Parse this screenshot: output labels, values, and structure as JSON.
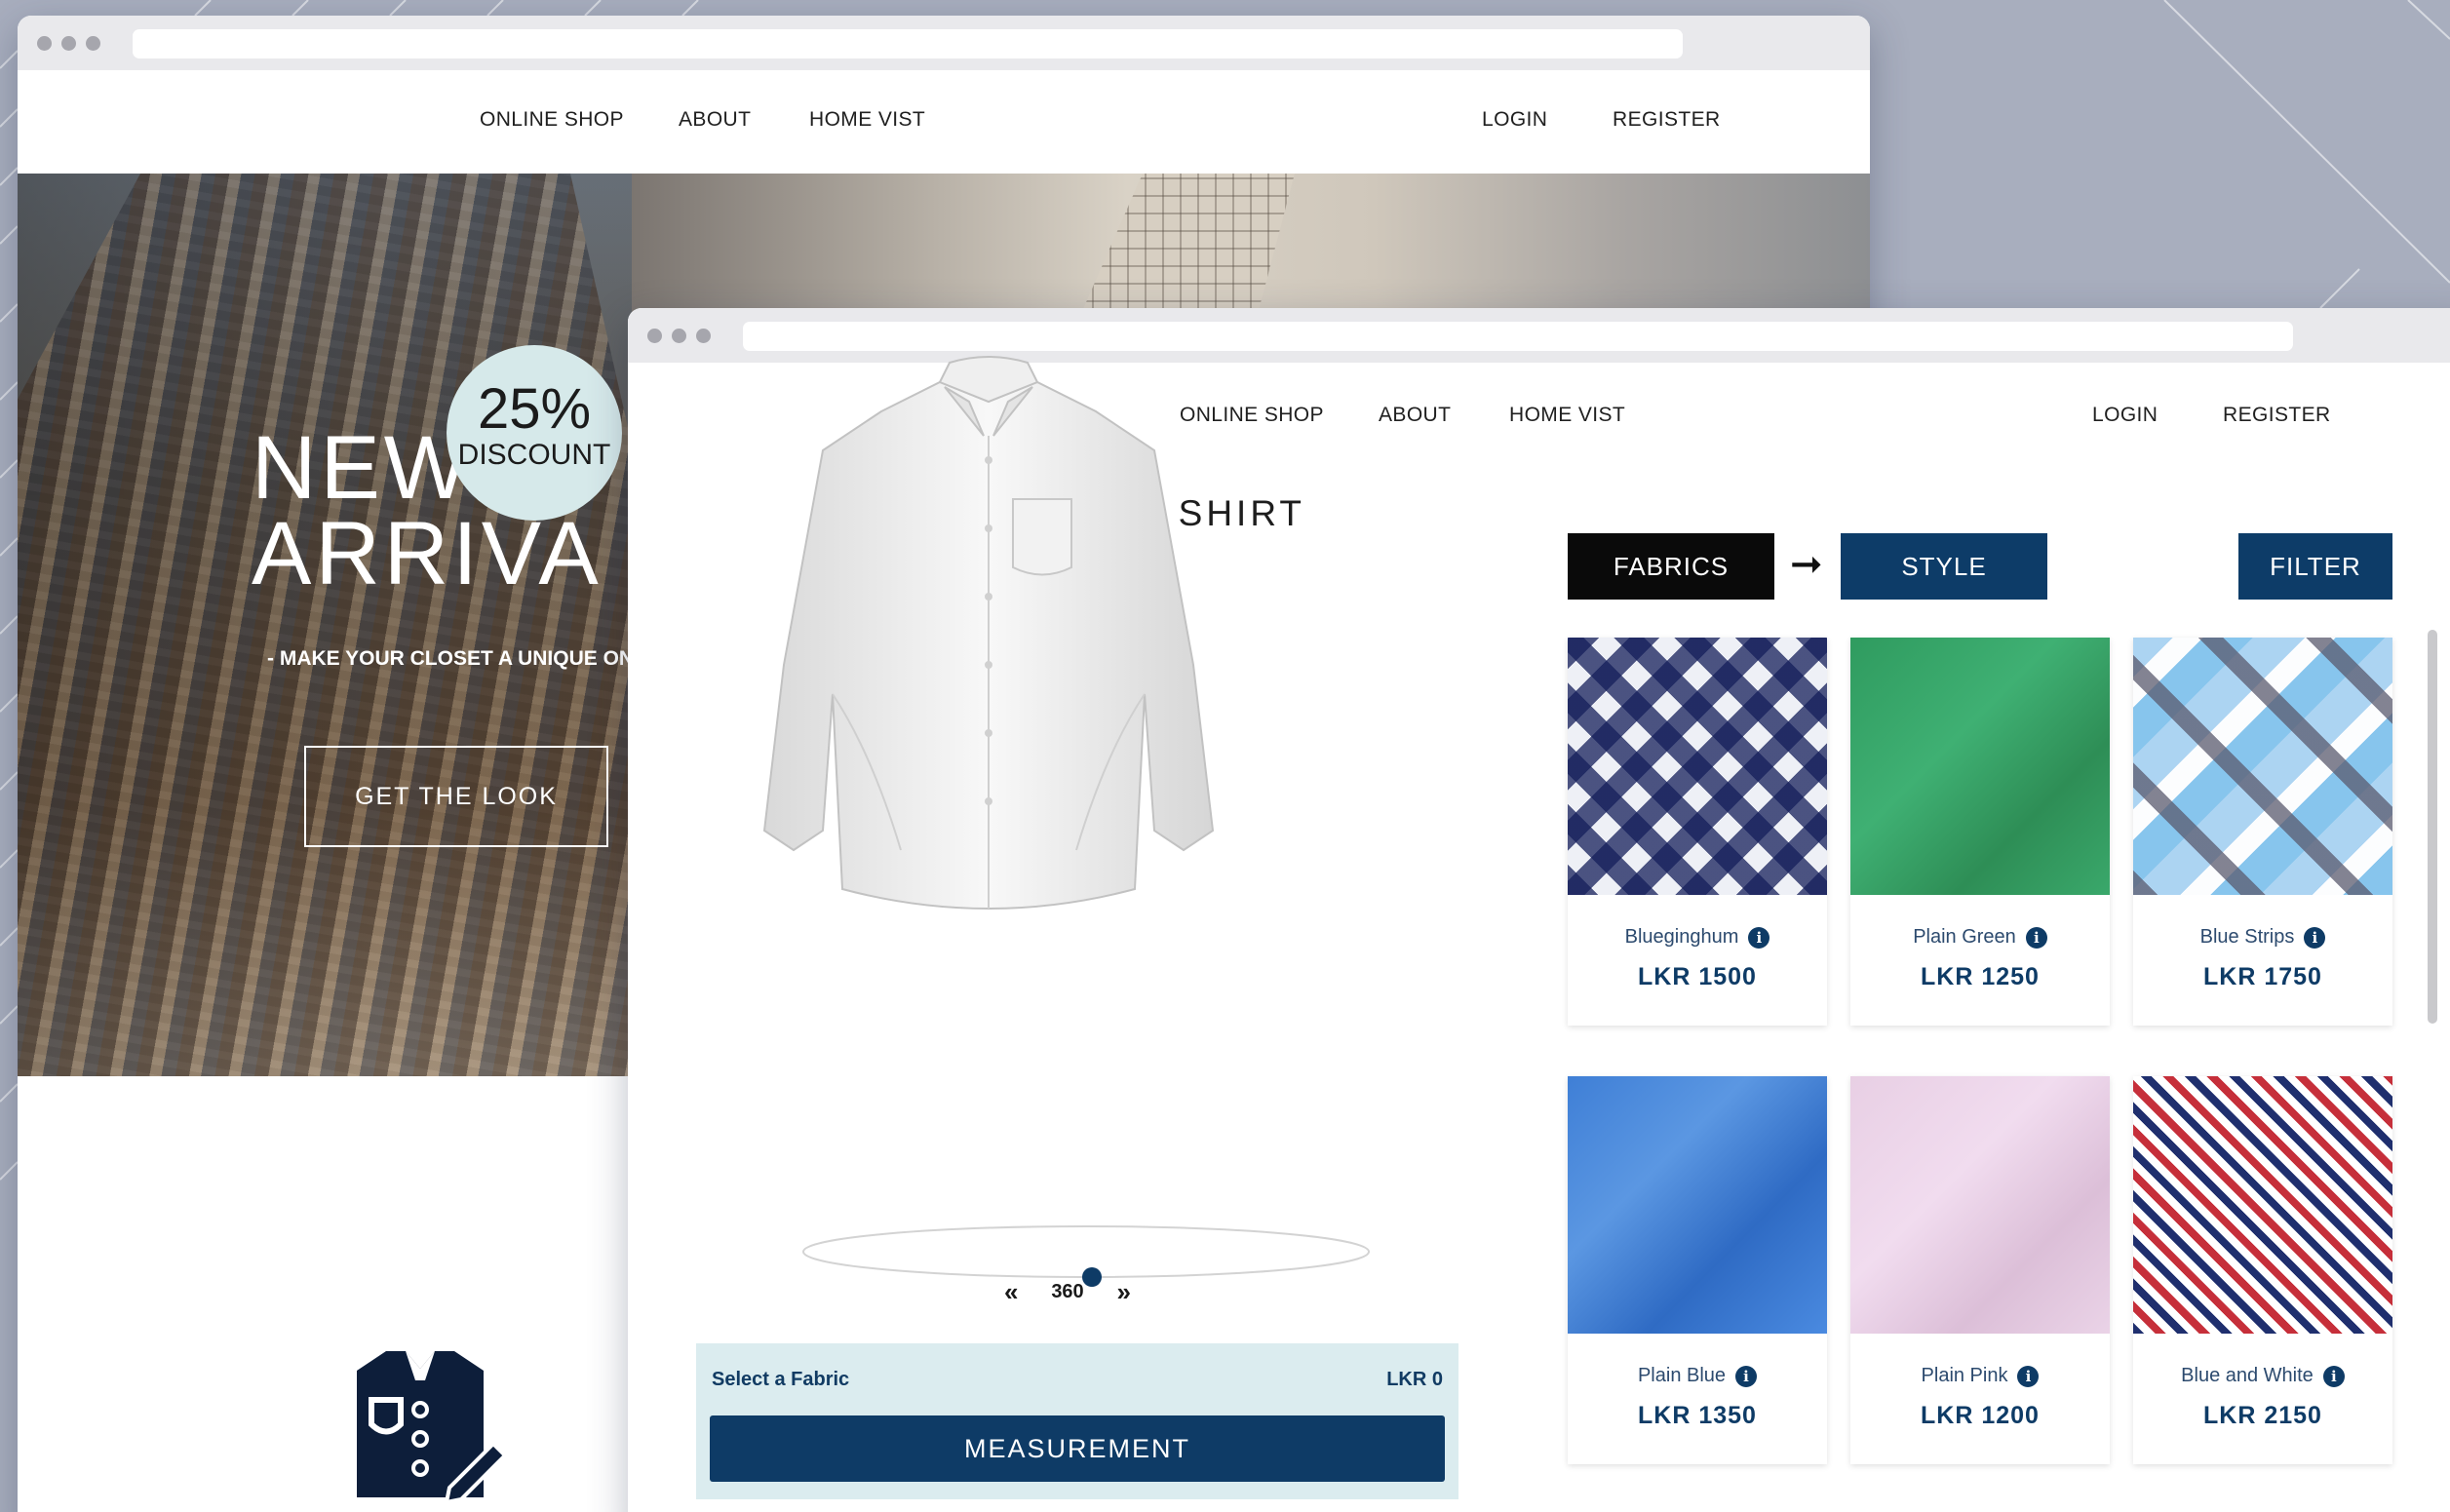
{
  "back_window": {
    "nav": {
      "online_shop": "ONLINE SHOP",
      "about": "ABOUT",
      "home_visit": "HOME VIST",
      "login": "LOGIN",
      "register": "REGISTER"
    },
    "hero": {
      "title_line1": "NEW",
      "title_line2": "ARRIVA",
      "discount_percent": "25%",
      "discount_label": "DISCOUNT",
      "subtitle": "- MAKE YOUR CLOSET A UNIQUE ONE",
      "cta_label": "GET THE LOOK"
    }
  },
  "front_window": {
    "nav": {
      "online_shop": "ONLINE SHOP",
      "about": "ABOUT",
      "home_visit": "HOME VIST",
      "login": "LOGIN",
      "register": "REGISTER"
    },
    "design": {
      "title": "DESIGN YOUR SHIRT",
      "rotate_label": "360",
      "fabric_prompt": "Select a Fabric",
      "fabric_price": "LKR 0",
      "measurement_label": "MEASUREMENT"
    },
    "tabs": {
      "fabrics": "FABRICS",
      "style": "STYLE",
      "filter": "FILTER"
    },
    "fabrics": [
      {
        "name": "Blueginghum",
        "price": "LKR 1500",
        "swatch": "gingham"
      },
      {
        "name": "Plain Green",
        "price": "LKR 1250",
        "swatch": "green"
      },
      {
        "name": "Blue Strips",
        "price": "LKR 1750",
        "swatch": "bluestrip"
      },
      {
        "name": "Plain Blue",
        "price": "LKR 1350",
        "swatch": "blue"
      },
      {
        "name": "Plain Pink",
        "price": "LKR 1200",
        "swatch": "pink"
      },
      {
        "name": "Blue and White",
        "price": "LKR 2150",
        "swatch": "bluewhite"
      }
    ]
  },
  "colors": {
    "accent": "#0e3b66",
    "tab_active": "#0a0a0a",
    "panel_bg": "#dbecef",
    "discount_badge": "#d6e9ea"
  }
}
